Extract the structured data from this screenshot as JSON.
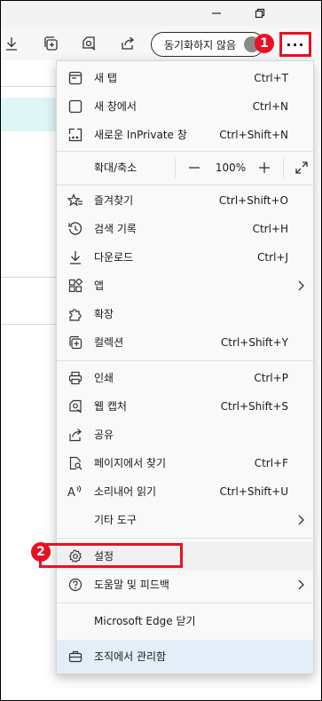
{
  "window": {
    "minimize_icon": "minimize-icon",
    "restore_icon": "restore-icon"
  },
  "toolbar": {
    "sync_label": "동기화하지 않음",
    "more_label": "···"
  },
  "callouts": {
    "one": "1",
    "two": "2"
  },
  "menu": {
    "new_tab": {
      "label": "새 탭",
      "shortcut": "Ctrl+T"
    },
    "new_window": {
      "label": "새 창에서",
      "shortcut": "Ctrl+N"
    },
    "new_inprivate": {
      "label": "새로운 InPrivate 창",
      "shortcut": "Ctrl+Shift+N"
    },
    "zoom": {
      "label": "확대/축소",
      "minus": "—",
      "value": "100%",
      "plus": "+"
    },
    "favorites": {
      "label": "즐겨찾기",
      "shortcut": "Ctrl+Shift+O"
    },
    "history": {
      "label": "검색 기록",
      "shortcut": "Ctrl+H"
    },
    "downloads": {
      "label": "다운로드",
      "shortcut": "Ctrl+J"
    },
    "apps": {
      "label": "앱"
    },
    "extensions": {
      "label": "확장"
    },
    "collections": {
      "label": "컬렉션",
      "shortcut": "Ctrl+Shift+Y"
    },
    "print": {
      "label": "인쇄",
      "shortcut": "Ctrl+P"
    },
    "web_capture": {
      "label": "웹 캡처",
      "shortcut": "Ctrl+Shift+S"
    },
    "share": {
      "label": "공유"
    },
    "find": {
      "label": "페이지에서 찾기",
      "shortcut": "Ctrl+F"
    },
    "read_aloud": {
      "label": "소리내어 읽기",
      "shortcut": "Ctrl+Shift+U"
    },
    "more_tools": {
      "label": "기타 도구"
    },
    "settings": {
      "label": "설정"
    },
    "help": {
      "label": "도움말 및 피드백"
    },
    "close_edge": {
      "label": "Microsoft Edge 닫기"
    },
    "managed": {
      "label": "조직에서 관리함"
    }
  },
  "colors": {
    "accent_red": "#e81123",
    "managed_bg": "#e3eef8",
    "page_strip": "#dff6f6"
  }
}
